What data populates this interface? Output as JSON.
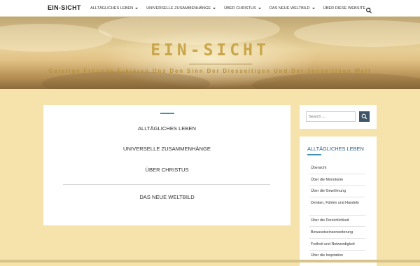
{
  "nav": {
    "brand": "EIN-SICHT",
    "items": [
      {
        "label": "ALLTÄGLICHES LEBEN",
        "has_dropdown": true
      },
      {
        "label": "UNIVERSELLE ZUSAMMENHÄNGE",
        "has_dropdown": true
      },
      {
        "label": "ÜBER CHRISTUS",
        "has_dropdown": true
      },
      {
        "label": "DAS NEUE WELTBILD",
        "has_dropdown": true
      },
      {
        "label": "ÜBER DIESE WEBSITE",
        "has_dropdown": true
      }
    ],
    "search_icon": "search-icon"
  },
  "hero": {
    "title": "EIN-SICHT",
    "tagline": "Geistige Freunde Erklären Uns Den Sinn Der Diesseitigen Und Der Jenseitigen Welt"
  },
  "main": {
    "links": [
      "ALLTÄGLICHES LEBEN",
      "UNIVERSELLE ZUSAMMENHÄNGE",
      "ÜBER CHRISTUS",
      "DAS NEUE WELTBILD"
    ]
  },
  "sidebar": {
    "search": {
      "placeholder": "Search ...",
      "icon": "search-icon"
    },
    "menu": {
      "title": "ALLTÄGLICHES LEBEN",
      "items": [
        "Übersicht",
        "Über die Monotonie",
        "Über die Gewöhnung",
        "Denken, Fühlen und Handeln",
        "Über die Persönlichkeit",
        "Bewusstseinserweiterung",
        "Freiheit und Notwendigkeit",
        "Über die Inspiration"
      ]
    }
  },
  "colors": {
    "page_background": "#f5e3ab",
    "accent": "#3f8fb0",
    "sidebar_title": "#2c5f86",
    "hero_title": "#caa64b",
    "search_button": "#3d5566"
  }
}
